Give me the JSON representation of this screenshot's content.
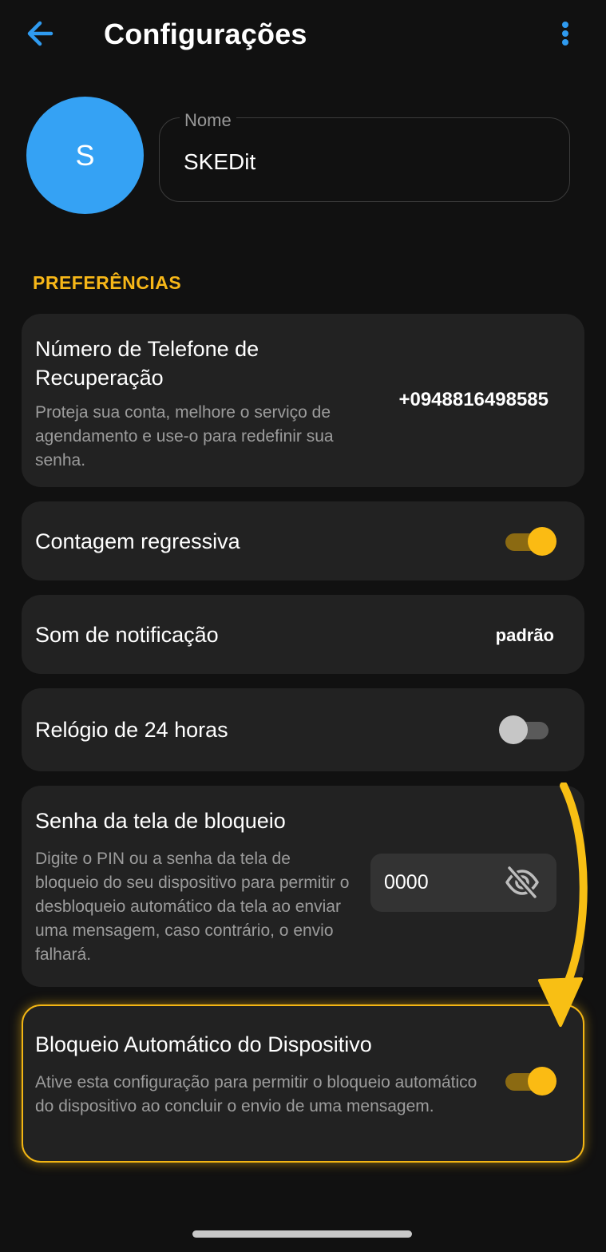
{
  "header": {
    "title": "Configurações",
    "back_icon": "arrow-left-icon",
    "menu_icon": "more-vertical-icon"
  },
  "profile": {
    "avatar_initial": "S",
    "name_label": "Nome",
    "name_value": "SKEDit"
  },
  "section_title": "PREFERÊNCIAS",
  "recovery_phone": {
    "title": "Número de Telefone de Recuperação",
    "description": "Proteja sua conta, melhore o serviço de agendamento e use-o para redefinir sua senha.",
    "value": "+0948816498585"
  },
  "countdown": {
    "title": "Contagem regressiva",
    "enabled": true
  },
  "notification_sound": {
    "title": "Som de notificação",
    "value": "padrão"
  },
  "clock_24h": {
    "title": "Relógio de 24 horas",
    "enabled": false
  },
  "lock_screen_password": {
    "title": "Senha da tela de bloqueio",
    "description": "Digite o PIN ou a senha da tela de bloqueio do seu dispositivo para permitir o desbloqueio automático da tela ao enviar uma mensagem, caso contrário, o envio falhará.",
    "value": "0000",
    "visibility_icon": "eye-off-icon"
  },
  "auto_lock": {
    "title": "Bloqueio Automático do Dispositivo",
    "description": "Ative esta configuração para permitir o bloqueio automático do dispositivo ao concluir o envio de uma mensagem.",
    "enabled": true
  },
  "colors": {
    "accent_blue": "#2f9bf0",
    "accent_yellow": "#f7b718",
    "background": "#111111",
    "card": "#222222"
  }
}
